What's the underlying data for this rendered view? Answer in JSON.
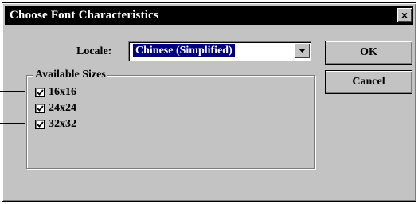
{
  "dialog": {
    "title": "Choose Font Characteristics",
    "close_symbol": "×"
  },
  "locale": {
    "label": "Locale:",
    "value": "Chinese (Simplified)"
  },
  "buttons": {
    "ok": "OK",
    "cancel": "Cancel"
  },
  "sizes": {
    "group_label": "Available Sizes",
    "items": [
      {
        "label": "16x16",
        "checked": true
      },
      {
        "label": "24x24",
        "checked": true
      },
      {
        "label": "32x32",
        "checked": true
      }
    ]
  },
  "icons": {
    "close": "close-icon",
    "dropdown": "chevron-down-icon",
    "check": "check-icon"
  }
}
